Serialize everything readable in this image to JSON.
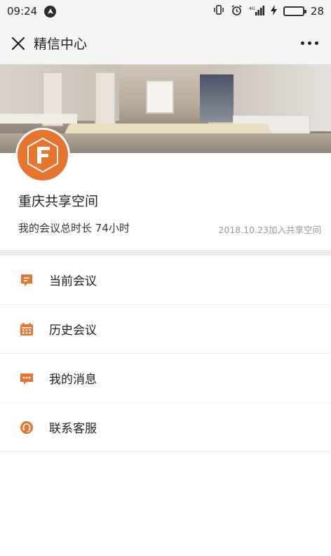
{
  "status_bar": {
    "time": "09:24",
    "battery": "28",
    "battery_level_percent": 28
  },
  "header": {
    "title": "精信中心"
  },
  "profile": {
    "name": "重庆共享空间",
    "duration": "我的会议总时长 74小时",
    "joined": "2018.10.23加入共享空间"
  },
  "menu": {
    "items": [
      {
        "label": "当前会议",
        "icon": "chat-icon"
      },
      {
        "label": "历史会议",
        "icon": "calendar-icon"
      },
      {
        "label": "我的消息",
        "icon": "message-icon"
      },
      {
        "label": "联系客服",
        "icon": "headset-icon"
      }
    ]
  },
  "colors": {
    "accent": "#e8742e"
  }
}
